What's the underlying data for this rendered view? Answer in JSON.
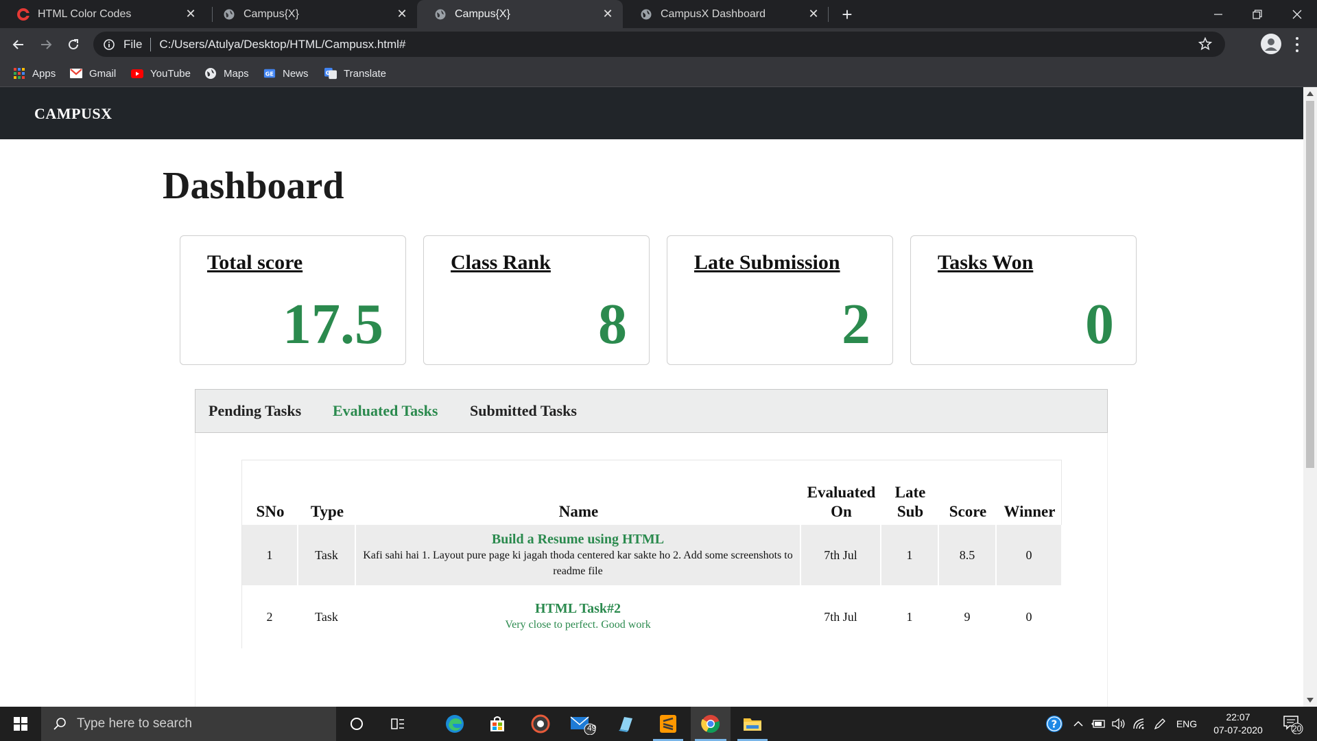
{
  "browser": {
    "tabs": [
      {
        "title": "HTML Color Codes",
        "favicon": "html-color-codes-favicon",
        "active": false
      },
      {
        "title": "Campus{X}",
        "favicon": "globe-icon",
        "active": false
      },
      {
        "title": "Campus{X}",
        "favicon": "globe-icon",
        "active": true
      },
      {
        "title": "CampusX Dashboard",
        "favicon": "globe-icon",
        "active": false
      }
    ],
    "address": {
      "scheme_label": "File",
      "url": "C:/Users/Atulya/Desktop/HTML/Campusx.html#"
    },
    "bookmarks": [
      {
        "label": "Apps",
        "icon": "apps-grid-icon"
      },
      {
        "label": "Gmail",
        "icon": "gmail-icon"
      },
      {
        "label": "YouTube",
        "icon": "youtube-icon"
      },
      {
        "label": "Maps",
        "icon": "maps-icon"
      },
      {
        "label": "News",
        "icon": "news-icon"
      },
      {
        "label": "Translate",
        "icon": "translate-icon"
      }
    ]
  },
  "site": {
    "brand": "CAMPUSX",
    "page_title": "Dashboard",
    "stats": [
      {
        "label": "Total score",
        "value": "17.5"
      },
      {
        "label": "Class Rank",
        "value": "8"
      },
      {
        "label": "Late Submission",
        "value": "2"
      },
      {
        "label": "Tasks Won",
        "value": "0"
      }
    ],
    "task_tabs": [
      {
        "label": "Pending Tasks",
        "active": false
      },
      {
        "label": "Evaluated Tasks",
        "active": true
      },
      {
        "label": "Submitted Tasks",
        "active": false
      }
    ],
    "table": {
      "headers": {
        "sno": "SNo",
        "type": "Type",
        "name": "Name",
        "evaluated_line1": "Evaluated",
        "evaluated_line2": "On",
        "late_line1": "Late",
        "late_line2": "Sub",
        "score": "Score",
        "winner": "Winner"
      },
      "rows": [
        {
          "sno": "1",
          "type": "Task",
          "name": "Build a Resume using HTML",
          "remark": "Kafi sahi hai 1. Layout pure page ki jagah thoda centered kar sakte ho 2. Add some screenshots to readme file",
          "evaluated_on": "7th Jul",
          "late_sub": "1",
          "score": "8.5",
          "winner": "0"
        },
        {
          "sno": "2",
          "type": "Task",
          "name": "HTML Task#2",
          "remark": "Very close to perfect. Good work",
          "evaluated_on": "7th Jul",
          "late_sub": "1",
          "score": "9",
          "winner": "0"
        }
      ]
    },
    "colors": {
      "accent_green": "#2b8a4e",
      "navbar": "#212529"
    }
  },
  "taskbar": {
    "search_placeholder": "Type here to search",
    "mail_badge": "49",
    "language": "ENG",
    "time": "22:07",
    "date": "07-07-2020",
    "notifications": "20"
  }
}
